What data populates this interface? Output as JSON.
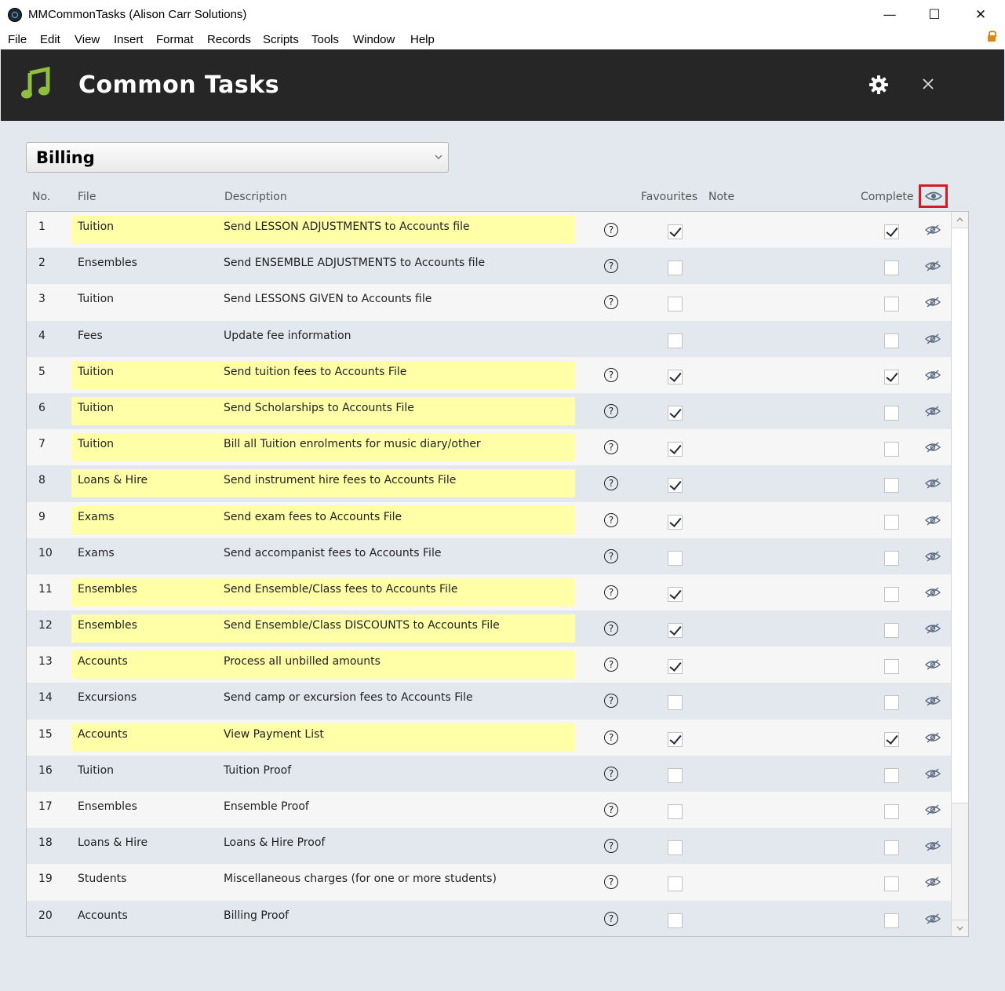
{
  "window": {
    "title": "MMCommonTasks (Alison Carr Solutions)",
    "minimize": "—",
    "maximize": "☐",
    "close": "✕"
  },
  "menu": [
    "File",
    "Edit",
    "View",
    "Insert",
    "Format",
    "Records",
    "Scripts",
    "Tools",
    "Window",
    "Help"
  ],
  "header": {
    "title": "Common Tasks",
    "icon": "music-note-icon",
    "accent_color": "#8ebf3f",
    "background": "#262626"
  },
  "category": {
    "selected": "Billing"
  },
  "columns": {
    "no": "No.",
    "file": "File",
    "description": "Description",
    "favourites": "Favourites",
    "note": "Note",
    "complete": "Complete"
  },
  "colors": {
    "highlight": "#ffffa8",
    "eye_button_border": "#d41a26"
  },
  "rows": [
    {
      "no": "1",
      "file": "Tuition",
      "desc": "Send LESSON ADJUSTMENTS to Accounts file",
      "help": true,
      "fav": true,
      "complete": true
    },
    {
      "no": "2",
      "file": "Ensembles",
      "desc": "Send ENSEMBLE ADJUSTMENTS to Accounts file",
      "help": true,
      "fav": false,
      "complete": false
    },
    {
      "no": "3",
      "file": "Tuition",
      "desc": "Send LESSONS GIVEN to Accounts file",
      "help": true,
      "fav": false,
      "complete": false
    },
    {
      "no": "4",
      "file": "Fees",
      "desc": "Update fee information",
      "help": false,
      "fav": false,
      "complete": false
    },
    {
      "no": "5",
      "file": "Tuition",
      "desc": "Send tuition fees to Accounts File",
      "help": true,
      "fav": true,
      "complete": true
    },
    {
      "no": "6",
      "file": "Tuition",
      "desc": "Send Scholarships to Accounts File",
      "help": true,
      "fav": true,
      "complete": false
    },
    {
      "no": "7",
      "file": "Tuition",
      "desc": "Bill all Tuition enrolments for music diary/other",
      "help": true,
      "fav": true,
      "complete": false
    },
    {
      "no": "8",
      "file": "Loans & Hire",
      "desc": "Send instrument hire fees to Accounts File",
      "help": true,
      "fav": true,
      "complete": false
    },
    {
      "no": "9",
      "file": "Exams",
      "desc": "Send exam fees to Accounts File",
      "help": true,
      "fav": true,
      "complete": false
    },
    {
      "no": "10",
      "file": "Exams",
      "desc": "Send accompanist fees to Accounts File",
      "help": true,
      "fav": false,
      "complete": false
    },
    {
      "no": "11",
      "file": "Ensembles",
      "desc": "Send Ensemble/Class fees to Accounts File",
      "help": true,
      "fav": true,
      "complete": false
    },
    {
      "no": "12",
      "file": "Ensembles",
      "desc": "Send Ensemble/Class DISCOUNTS to Accounts File",
      "help": true,
      "fav": true,
      "complete": false
    },
    {
      "no": "13",
      "file": "Accounts",
      "desc": "Process all unbilled amounts",
      "help": true,
      "fav": true,
      "complete": false
    },
    {
      "no": "14",
      "file": "Excursions",
      "desc": "Send camp or excursion fees to Accounts File",
      "help": true,
      "fav": false,
      "complete": false
    },
    {
      "no": "15",
      "file": "Accounts",
      "desc": "View Payment List",
      "help": true,
      "fav": true,
      "complete": true
    },
    {
      "no": "16",
      "file": "Tuition",
      "desc": "Tuition Proof",
      "help": true,
      "fav": false,
      "complete": false
    },
    {
      "no": "17",
      "file": "Ensembles",
      "desc": "Ensemble Proof",
      "help": true,
      "fav": false,
      "complete": false
    },
    {
      "no": "18",
      "file": "Loans & Hire",
      "desc": "Loans & Hire Proof",
      "help": true,
      "fav": false,
      "complete": false
    },
    {
      "no": "19",
      "file": "Students",
      "desc": "Miscellaneous charges (for one or more students)",
      "help": true,
      "fav": false,
      "complete": false
    },
    {
      "no": "20",
      "file": "Accounts",
      "desc": "Billing Proof",
      "help": true,
      "fav": false,
      "complete": false
    }
  ],
  "icons": {
    "help": "?",
    "row_hide": "eye-slash-icon",
    "show_hidden": "eye-icon",
    "settings": "gear-icon",
    "close": "close-icon",
    "dropdown": "chevron-down-icon"
  }
}
